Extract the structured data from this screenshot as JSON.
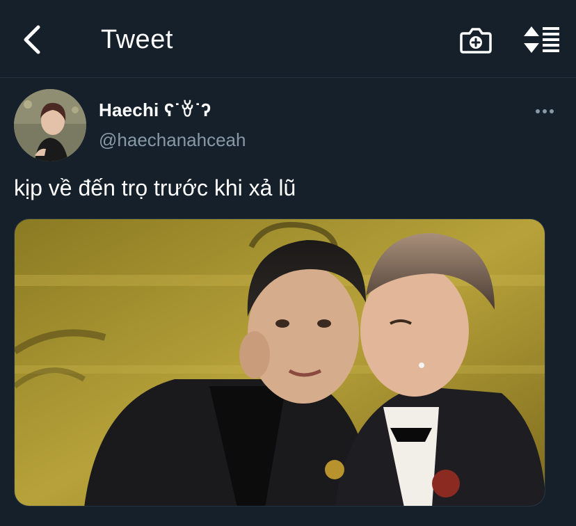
{
  "header": {
    "title": "Tweet",
    "back_icon": "chevron-left-icon",
    "camera_icon": "camera-add-icon",
    "sort_icon": "sort-list-icon"
  },
  "tweet": {
    "author_name": "Haechi ʕ˙ꈊ˙ʔ",
    "author_handle": "@haechanahceah",
    "text": "kịp về đến trọ trước khi xả lũ",
    "more_icon": "more-horizontal-icon"
  },
  "colors": {
    "background": "#15202b",
    "muted_text": "#8899a6",
    "divider": "#253341"
  }
}
